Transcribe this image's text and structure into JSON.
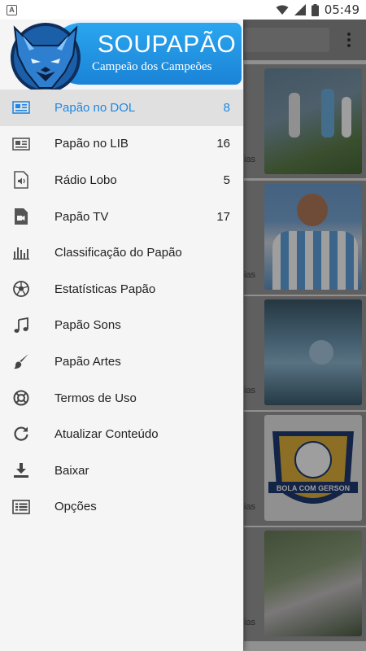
{
  "status_bar": {
    "left_badge": "A",
    "time": "05:49",
    "icons": [
      "wifi-icon",
      "signal-icon",
      "battery-icon"
    ]
  },
  "brand": {
    "title": "SOUPAPÃO",
    "subtitle": "Campeão dos Campeões",
    "colors": {
      "banner": "#1b83d6",
      "accent": "#1e88e5"
    }
  },
  "menu": {
    "items": [
      {
        "label": "Papão no DOL",
        "count": "8",
        "icon": "news-icon",
        "active": true
      },
      {
        "label": "Papão no LIB",
        "count": "16",
        "icon": "news-icon",
        "active": false
      },
      {
        "label": "Rádio Lobo",
        "count": "5",
        "icon": "audio-file-icon",
        "active": false
      },
      {
        "label": "Papão TV",
        "count": "17",
        "icon": "video-file-icon",
        "active": false
      },
      {
        "label": "Classificação do Papão",
        "count": "",
        "icon": "bar-chart-icon",
        "active": false
      },
      {
        "label": "Estatísticas Papão",
        "count": "",
        "icon": "soccer-ball-icon",
        "active": false
      },
      {
        "label": "Papão Sons",
        "count": "",
        "icon": "music-note-icon",
        "active": false
      },
      {
        "label": "Papão Artes",
        "count": "",
        "icon": "brush-icon",
        "active": false
      },
      {
        "label": "Termos de Uso",
        "count": "",
        "icon": "lifebuoy-icon",
        "active": false
      },
      {
        "label": "Atualizar Conteúdo",
        "count": "",
        "icon": "refresh-icon",
        "active": false
      },
      {
        "label": "Baixar",
        "count": "",
        "icon": "download-icon",
        "active": false
      },
      {
        "label": "Opções",
        "count": "",
        "icon": "list-icon",
        "active": false
      }
    ]
  },
  "background": {
    "cards": [
      {
        "caption": "ias"
      },
      {
        "caption": "ias"
      },
      {
        "caption": "ias"
      },
      {
        "caption": "ias"
      },
      {
        "caption": "ias"
      }
    ]
  }
}
